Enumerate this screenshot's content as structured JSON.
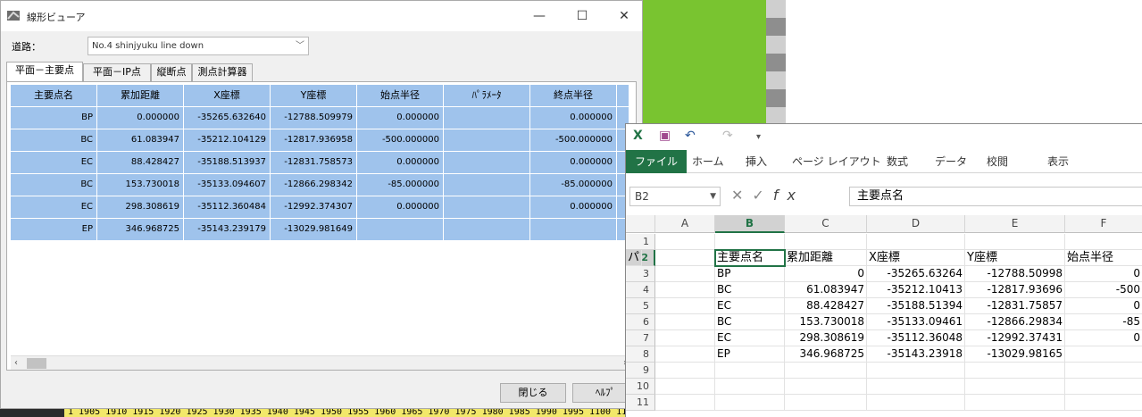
{
  "background": {
    "ruler_text": "1 1905 1910 1915 1920 1925 1930 1935 1940 1945 1950 1955 1960 1965 1970 1975 1980 1985 1990 1995 1100 11"
  },
  "dialog": {
    "title": "線形ビューア",
    "window_controls": {
      "minimize": "—",
      "maximize": "☐",
      "close": "✕"
    },
    "road_label": "道路：",
    "road_value": "No.4 shinjyuku line down",
    "tabs": [
      "平面－主要点",
      "平面－IP点",
      "縦断点",
      "測点計算器"
    ],
    "grid": {
      "headers": [
        "主要点名",
        "累加距離",
        "X座標",
        "Y座標",
        "始点半径",
        "ﾊﾟﾗﾒｰﾀ",
        "終点半径"
      ],
      "rows": [
        [
          "BP",
          "0.000000",
          "-35265.632640",
          "-12788.509979",
          "0.000000",
          "",
          "0.000000"
        ],
        [
          "BC",
          "61.083947",
          "-35212.104129",
          "-12817.936958",
          "-500.000000",
          "",
          "-500.000000"
        ],
        [
          "EC",
          "88.428427",
          "-35188.513937",
          "-12831.758573",
          "0.000000",
          "",
          "0.000000"
        ],
        [
          "BC",
          "153.730018",
          "-35133.094607",
          "-12866.298342",
          "-85.000000",
          "",
          "-85.000000"
        ],
        [
          "EC",
          "298.308619",
          "-35112.360484",
          "-12992.374307",
          "0.000000",
          "",
          "0.000000"
        ],
        [
          "EP",
          "346.968725",
          "-35143.239179",
          "-13029.981649",
          "",
          "",
          ""
        ]
      ]
    },
    "buttons": {
      "close": "閉じる",
      "help": "ﾍﾙﾌﾟ"
    }
  },
  "excel": {
    "ribbon_tabs": [
      "ファイル",
      "ホーム",
      "挿入",
      "ページ レイアウト",
      "数式",
      "データ",
      "校閲",
      "表示"
    ],
    "name_box": "B2",
    "formula": "主要点名",
    "columns": [
      "A",
      "B",
      "C",
      "D",
      "E",
      "F"
    ],
    "row_numbers": [
      "1",
      "2",
      "3",
      "4",
      "5",
      "6",
      "7",
      "8",
      "9",
      "10",
      "11"
    ],
    "header_row": [
      "主要点名",
      "累加距離",
      "X座標",
      "Y座標",
      "始点半径",
      "パ"
    ],
    "data_rows": [
      [
        "BP",
        "0",
        "-35265.63264",
        "-12788.50998",
        "0"
      ],
      [
        "BC",
        "61.083947",
        "-35212.10413",
        "-12817.93696",
        "-500"
      ],
      [
        "EC",
        "88.428427",
        "-35188.51394",
        "-12831.75857",
        "0"
      ],
      [
        "BC",
        "153.730018",
        "-35133.09461",
        "-12866.29834",
        "-85"
      ],
      [
        "EC",
        "298.308619",
        "-35112.36048",
        "-12992.37431",
        "0"
      ],
      [
        "EP",
        "346.968725",
        "-35143.23918",
        "-13029.98165",
        ""
      ]
    ],
    "accent_color": "#217346"
  }
}
